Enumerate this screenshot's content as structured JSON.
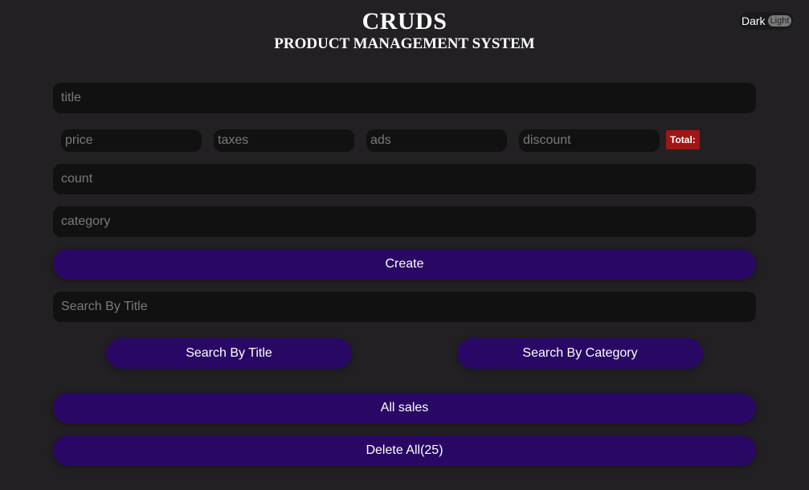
{
  "header": {
    "title": "CRUDS",
    "subtitle": "PRODUCT MANAGEMENT SYSTEM"
  },
  "theme_toggle": {
    "dark_label": "Dark",
    "light_label": "Light"
  },
  "form": {
    "title_placeholder": "title",
    "price_placeholder": "price",
    "taxes_placeholder": "taxes",
    "ads_placeholder": "ads",
    "discount_placeholder": "discount",
    "total_label": "Total:",
    "count_placeholder": "count",
    "category_placeholder": "category",
    "create_label": "Create"
  },
  "search": {
    "input_placeholder": "Search By Title",
    "by_title_label": "Search By Title",
    "by_category_label": "Search By Category"
  },
  "actions": {
    "all_sales_label": "All sales",
    "delete_all_label": "Delete All(25)"
  },
  "colors": {
    "background": "#222023",
    "input_bg": "#111111",
    "button_bg": "#290865",
    "total_badge_bg": "#a01616"
  }
}
